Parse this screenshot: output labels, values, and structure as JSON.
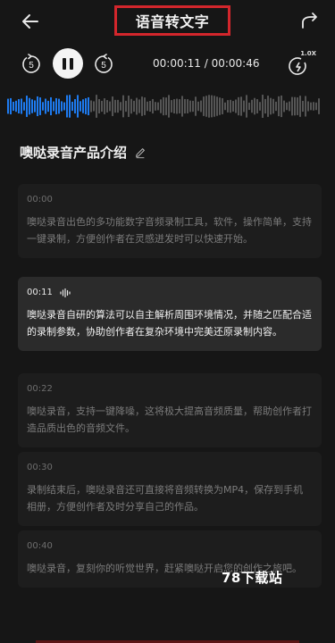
{
  "header": {
    "title": "语音转文字"
  },
  "player": {
    "current_time": "00:00:11",
    "separator": " / ",
    "total_time": "00:00:46",
    "speed_label": "1.0X",
    "skip_back_label": "5",
    "skip_forward_label": "5",
    "progress_fraction": 0.26
  },
  "document": {
    "title": "噢哒录音产品介绍"
  },
  "segments": [
    {
      "time": "00:00",
      "text": "噢哒录音出色的多功能数字音频录制工具，软件，操作简单，支持一键录制，方便创作者在灵感迸发时可以快速开始。",
      "active": false
    },
    {
      "time": "00:11",
      "text": "噢哒录音自研的算法可以自主解析周围环境情况，并随之匹配合适的录制参数，协助创作者在复杂环境中完美还原录制内容。",
      "active": true
    },
    {
      "time": "00:22",
      "text": "噢哒录音，支持一键降噪，这将极大提高音频质量，帮助创作者打造品质出色的音频文件。",
      "active": false
    },
    {
      "time": "00:30",
      "text": "录制结束后，噢哒录音还可直接将音频转换为MP4，保存到手机相册，方便创作者及时分享自己的作品。",
      "active": false
    },
    {
      "time": "00:40",
      "text": "噢哒录音，复刻你的听觉世界，赶紧噢哒开启您的创作之旅吧。",
      "active": false
    }
  ],
  "watermark": "78下载站",
  "colors": {
    "background": "#161616",
    "highlight_box": "#d3262c",
    "waveform_played": "#1e7bf0",
    "waveform_unplayed": "#555555"
  }
}
